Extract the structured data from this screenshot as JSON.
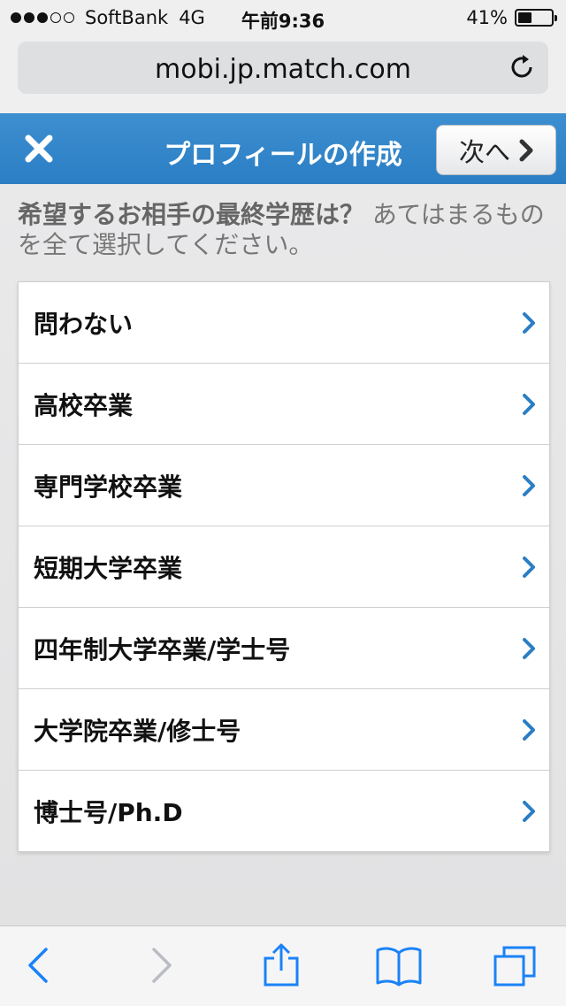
{
  "status_bar": {
    "carrier": "SoftBank",
    "network": "4G",
    "time": "午前9:36",
    "battery": "41%",
    "battery_level": 0.41
  },
  "address_bar": {
    "url": "mobi.jp.match.com"
  },
  "header": {
    "title": "プロフィールの作成",
    "next_label": "次へ"
  },
  "question": {
    "main": "希望するお相手の最終学歴は？",
    "hint": "あてはまるものを全て選択してください。"
  },
  "options": [
    {
      "label": "問わない"
    },
    {
      "label": "高校卒業"
    },
    {
      "label": "専門学校卒業"
    },
    {
      "label": "短期大学卒業"
    },
    {
      "label": "四年制大学卒業/学士号"
    },
    {
      "label": "大学院卒業/修士号"
    },
    {
      "label": "博士号/Ph.D"
    }
  ],
  "colors": {
    "header_blue": "#2b7ec4",
    "chevron_blue": "#2b7ec4",
    "toolbar_blue": "#1a82f7"
  },
  "icons": {
    "close": "close-icon",
    "reload": "reload-icon",
    "chevron": "chevron-right-icon",
    "back": "back-icon",
    "forward": "forward-icon",
    "share": "share-icon",
    "bookmarks": "bookmarks-icon",
    "tabs": "tabs-icon"
  }
}
